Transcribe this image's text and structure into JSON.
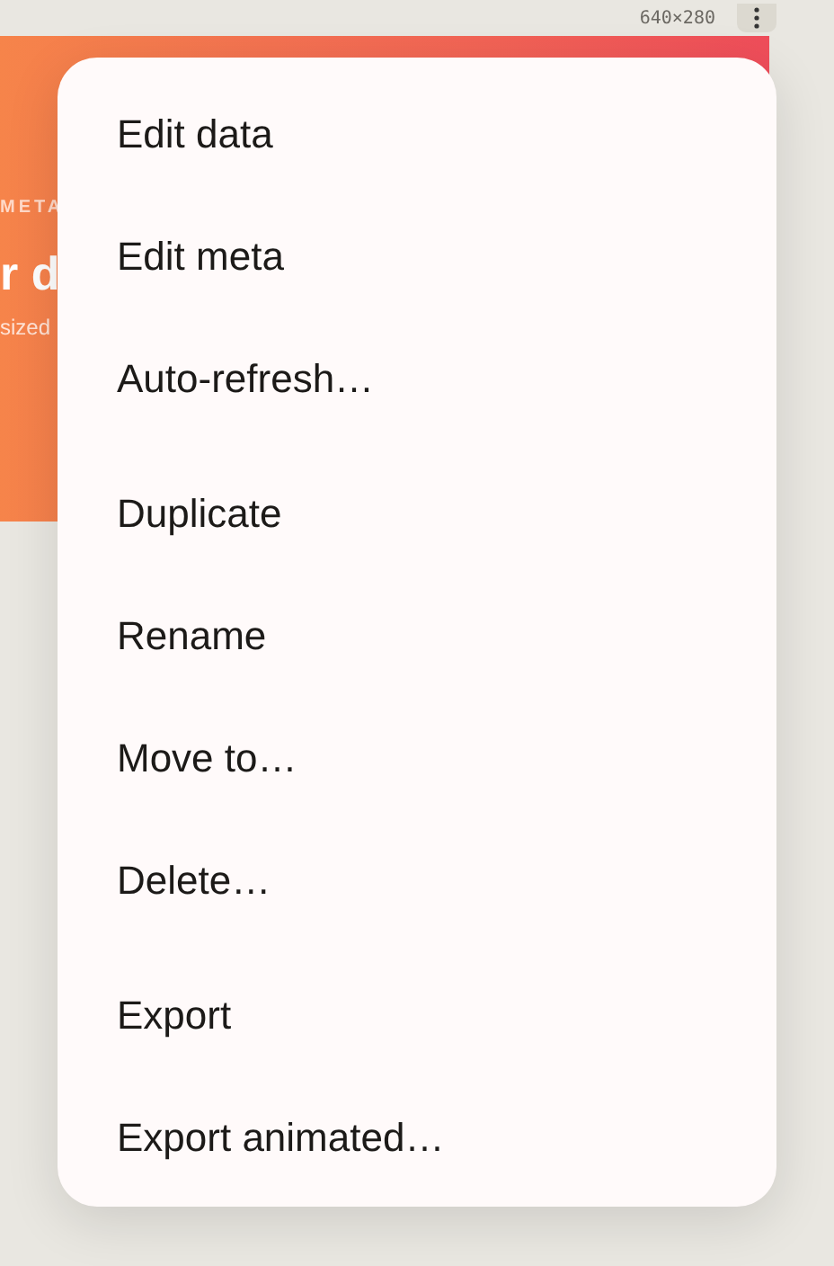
{
  "toolbar": {
    "size_label": "640×280"
  },
  "card": {
    "eyebrow": "META",
    "title": "r d",
    "subtitle": "sized"
  },
  "menu": {
    "groups": [
      {
        "items": [
          {
            "label": "Edit data"
          },
          {
            "label": "Edit meta"
          },
          {
            "label": "Auto-refresh…"
          }
        ]
      },
      {
        "items": [
          {
            "label": "Duplicate"
          },
          {
            "label": "Rename"
          },
          {
            "label": "Move to…"
          },
          {
            "label": "Delete…"
          }
        ]
      },
      {
        "items": [
          {
            "label": "Export"
          },
          {
            "label": "Export animated…"
          }
        ]
      }
    ]
  }
}
